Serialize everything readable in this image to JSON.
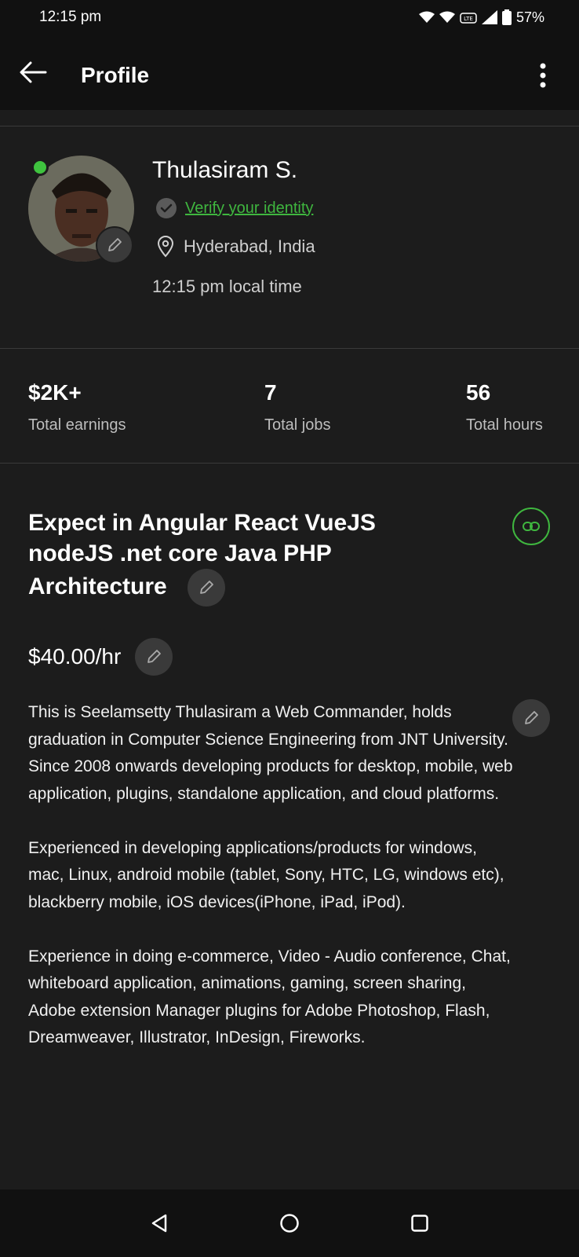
{
  "status_bar": {
    "time": "12:15 pm",
    "battery": "57%"
  },
  "app_bar": {
    "title": "Profile"
  },
  "profile": {
    "name": "Thulasiram S.",
    "verify_label": "Verify your identity",
    "location": "Hyderabad, India",
    "local_time": "12:15 pm local time",
    "online_color": "#3fc33f"
  },
  "stats": [
    {
      "value": "$2K+",
      "label": "Total earnings"
    },
    {
      "value": "7",
      "label": "Total jobs"
    },
    {
      "value": "56",
      "label": "Total hours"
    }
  ],
  "title_section": {
    "headline": "Expect in Angular React VueJS nodeJS .net core Java PHP Architecture",
    "rate": "$40.00/hr"
  },
  "description": {
    "paragraphs": [
      "This is Seelamsetty Thulasiram a Web Commander, holds graduation in Computer Science Engineering from JNT University.\nSince 2008 onwards developing products for desktop, mobile, web application, plugins, standalone application, and cloud platforms.",
      "Experienced in developing applications/products for windows, mac, Linux, android mobile (tablet, Sony, HTC, LG, windows etc), blackberry mobile, iOS devices(iPhone, iPad, iPod).",
      "Experience in doing e-commerce, Video - Audio conference, Chat, whiteboard application, animations, gaming, screen sharing, Adobe extension Manager plugins for Adobe Photoshop, Flash, Dreamweaver, Illustrator, InDesign, Fireworks."
    ]
  },
  "colors": {
    "accent_green": "#3fb63f",
    "background": "#1c1c1c",
    "bar_background": "#111111"
  },
  "icons": [
    "back-arrow-icon",
    "more-vertical-icon",
    "pencil-icon",
    "verified-badge-icon",
    "location-pin-icon",
    "link-icon",
    "nav-back-icon",
    "nav-home-icon",
    "nav-recents-icon"
  ]
}
